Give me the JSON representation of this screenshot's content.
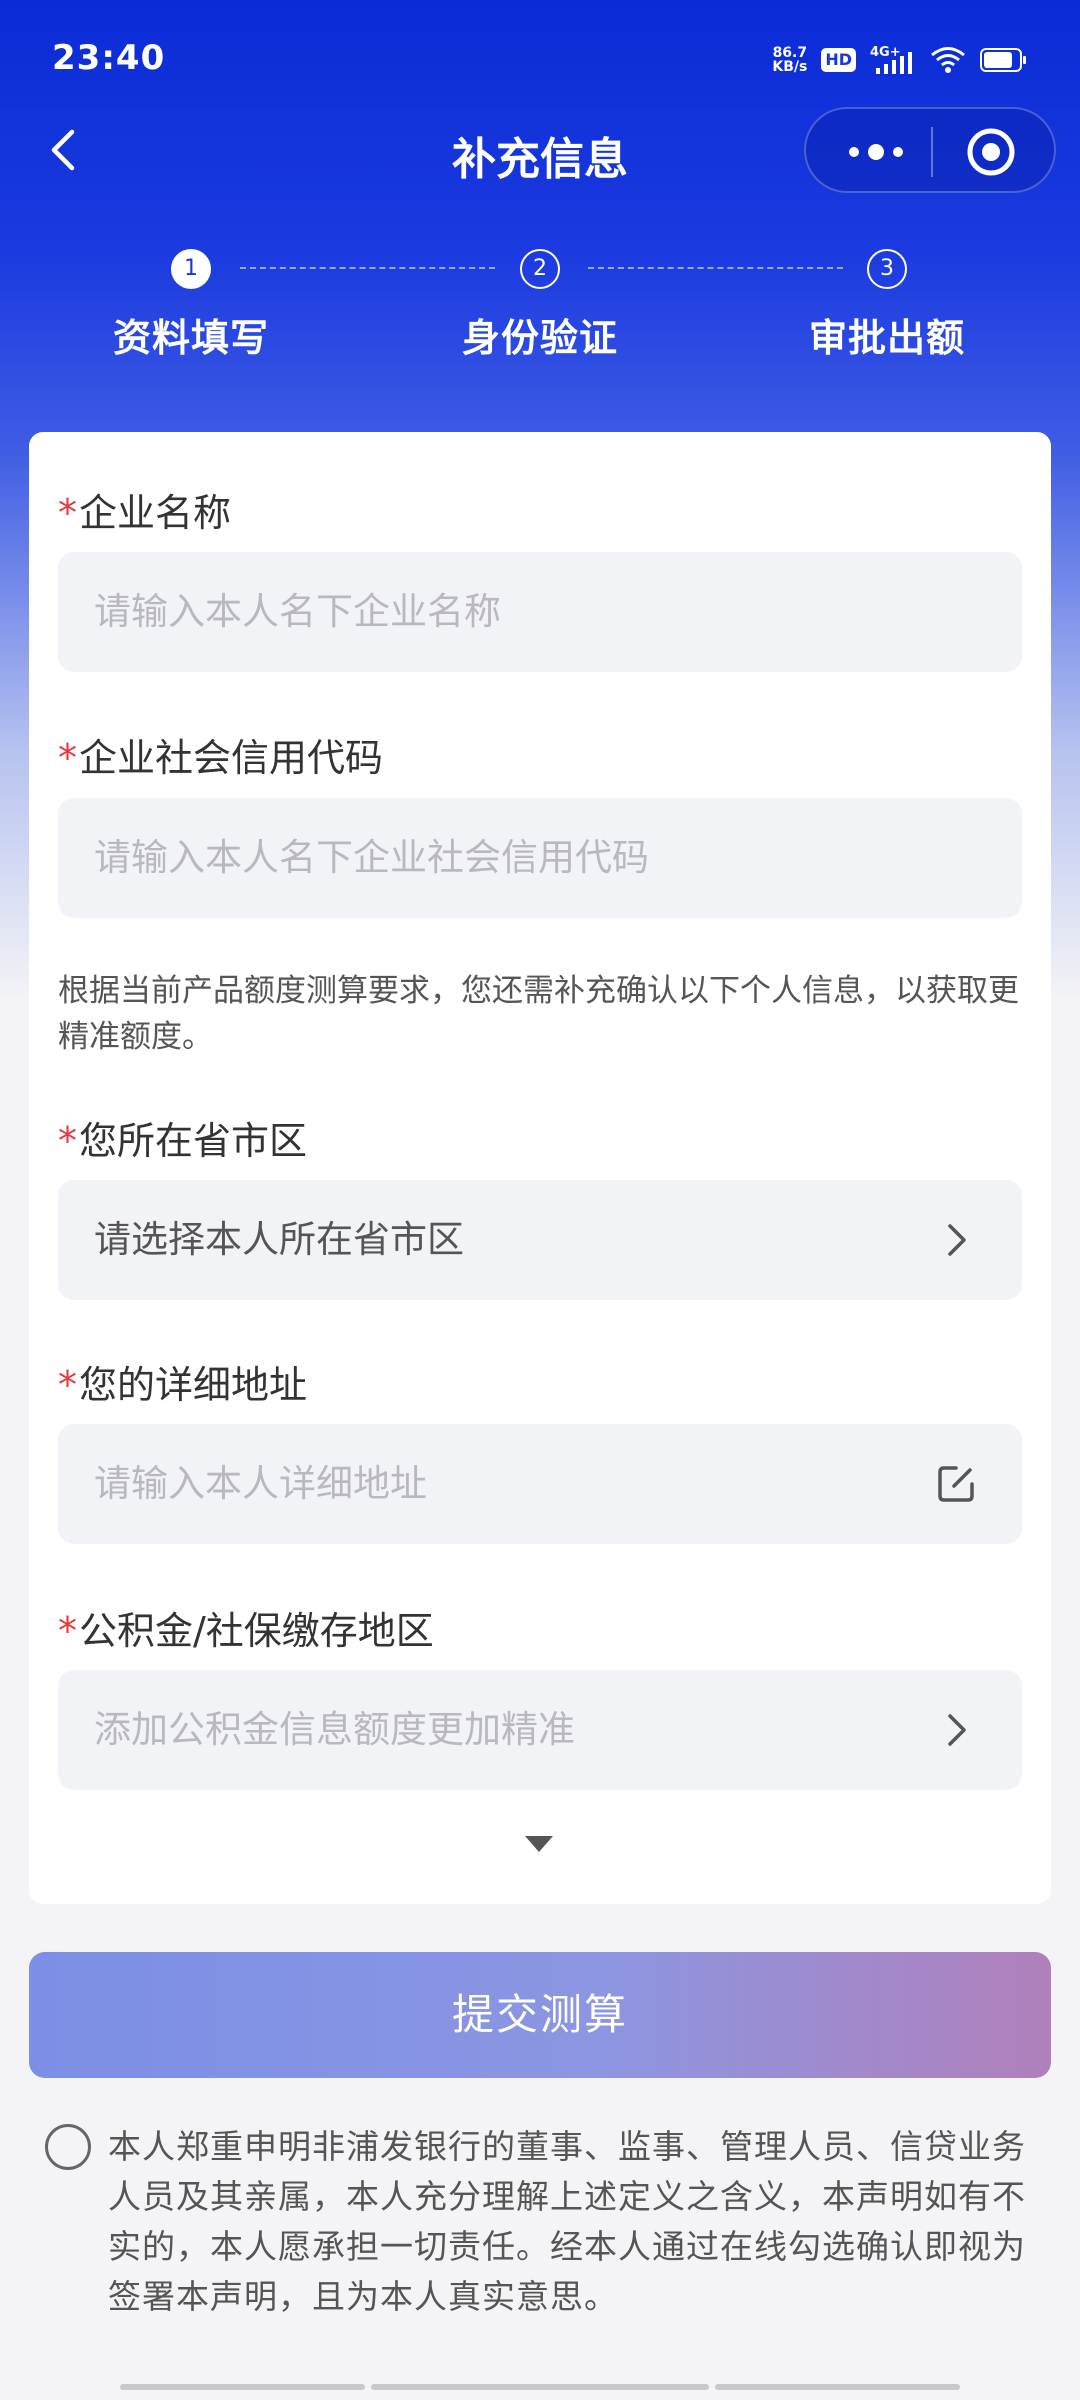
{
  "status": {
    "time": "23:40",
    "net_speed_value": "86.7",
    "net_speed_unit": "KB/s",
    "hd": "HD",
    "network": "4G+"
  },
  "nav": {
    "title": "补充信息",
    "back_icon": "chevron-left-icon",
    "more_icon": "more-dots-icon",
    "close_icon": "target-circle-icon"
  },
  "steps": [
    {
      "num": "1",
      "label": "资料填写",
      "active": true
    },
    {
      "num": "2",
      "label": "身份验证",
      "active": false
    },
    {
      "num": "3",
      "label": "审批出额",
      "active": false
    }
  ],
  "form": {
    "company_name": {
      "required": "*",
      "label": "企业名称",
      "placeholder": "请输入本人名下企业名称"
    },
    "credit_code": {
      "required": "*",
      "label": "企业社会信用代码",
      "placeholder": "请输入本人名下企业社会信用代码"
    },
    "note": "根据当前产品额度测算要求，您还需补充确认以下个人信息，以获取更精准额度。",
    "region": {
      "required": "*",
      "label": "您所在省市区",
      "value": "请选择本人所在省市区",
      "icon": "chevron-right-icon"
    },
    "address": {
      "required": "*",
      "label": "您的详细地址",
      "placeholder": "请输入本人详细地址",
      "icon": "edit-icon"
    },
    "fund_region": {
      "required": "*",
      "label": "公积金/社保缴存地区",
      "placeholder": "添加公积金信息额度更加精准",
      "icon": "chevron-right-icon"
    },
    "expand_icon": "triangle-down-icon"
  },
  "submit_label": "提交测算",
  "agreement": {
    "checked": false,
    "text": "本人郑重申明非浦发银行的董事、监事、管理人员、信贷业务人员及其亲属，本人充分理解上述定义之含义，本声明如有不实的，本人愿承担一切责任。经本人通过在线勾选确认即视为签署本声明，且为本人真实意思。"
  },
  "colors": {
    "primary": "#1a36df",
    "required": "#e4393c",
    "field_bg": "#f2f3f7",
    "placeholder": "#b8b8be"
  }
}
